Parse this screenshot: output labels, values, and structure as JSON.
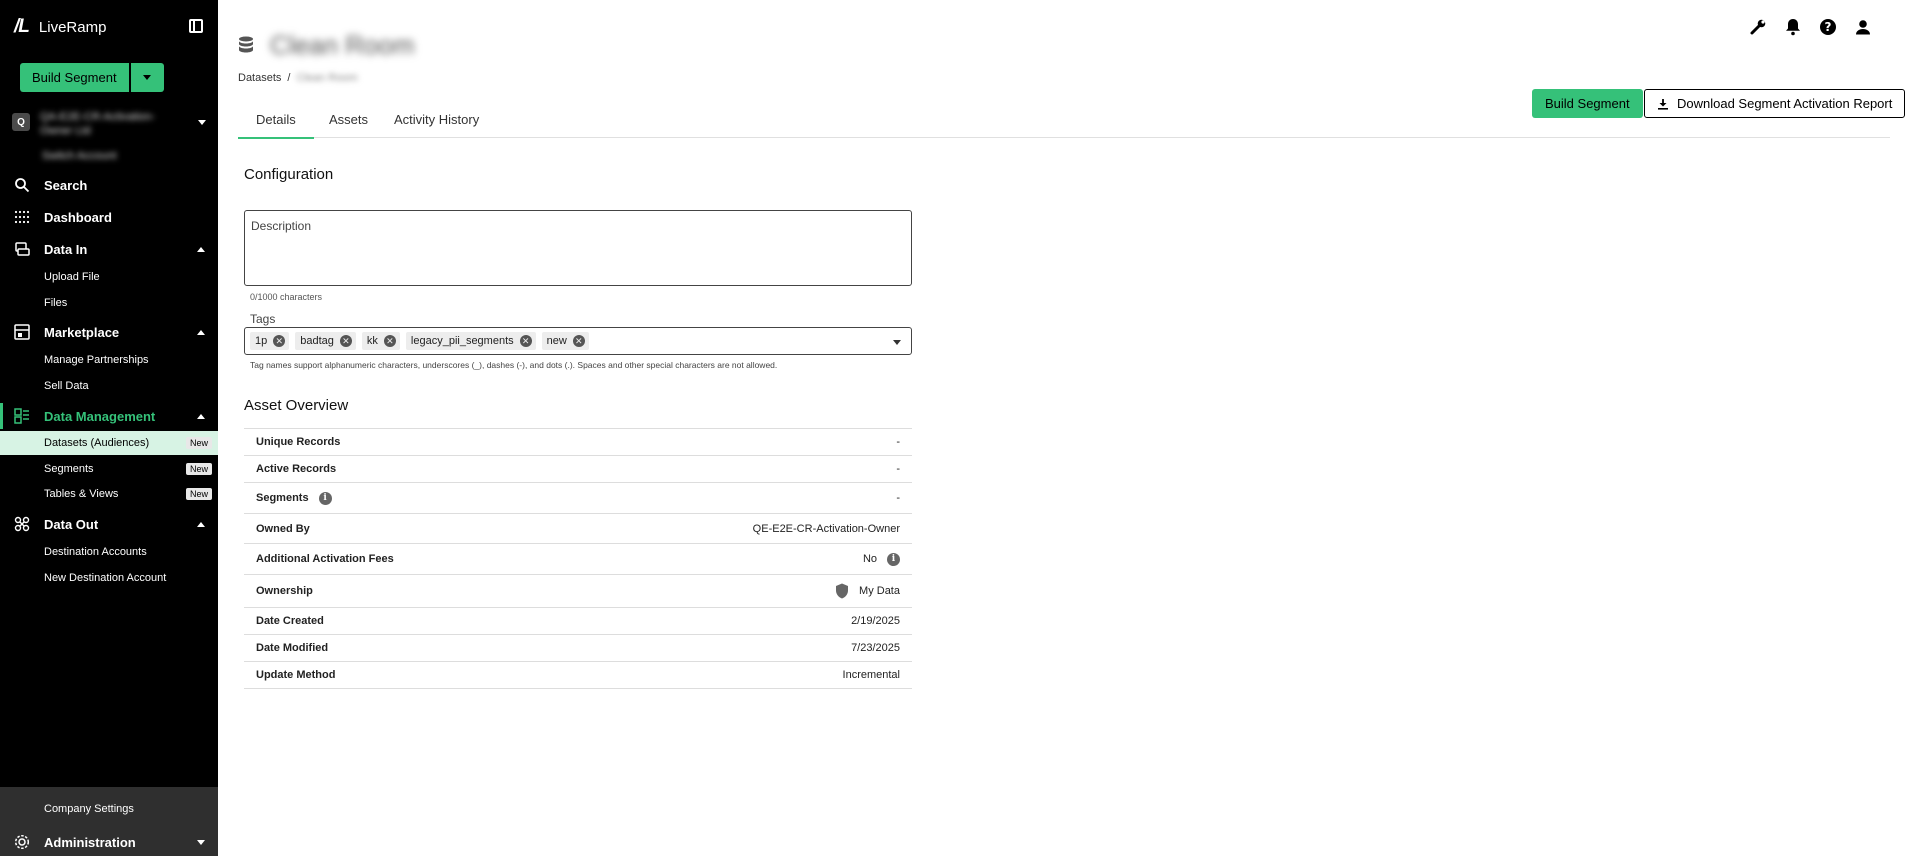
{
  "app": {
    "logo_mark": "/L",
    "name": "LiveRamp",
    "build_segment_label": "Build Segment"
  },
  "org": {
    "badge": "Q",
    "name": "QA-E2E-CR-Activation-Owner Ltd",
    "subtitle": "Switch Account"
  },
  "sidebar": {
    "search": "Search",
    "dashboard": "Dashboard",
    "data_in": "Data In",
    "upload_file": "Upload File",
    "files": "Files",
    "marketplace": "Marketplace",
    "manage_partnerships": "Manage Partnerships",
    "sell_data": "Sell Data",
    "data_management": "Data Management",
    "datasets": "Datasets (Audiences)",
    "segments": "Segments",
    "tables_views": "Tables & Views",
    "new_badge": "New",
    "data_out": "Data Out",
    "destination_accounts": "Destination Accounts",
    "new_destination_account": "New Destination Account",
    "company_settings": "Company Settings",
    "administration": "Administration"
  },
  "page": {
    "title": "Clean Room",
    "breadcrumb_root": "Datasets",
    "breadcrumb_sep": "/",
    "breadcrumb_current": "Clean Room"
  },
  "tabs": [
    "Details",
    "Assets",
    "Activity History"
  ],
  "actions": {
    "build_segment": "Build Segment",
    "download_report": "Download Segment Activation Report"
  },
  "configuration": {
    "title": "Configuration",
    "description_label": "Description",
    "char_count": "0/1000 characters",
    "tags_label": "Tags",
    "tags": [
      "1p",
      "badtag",
      "kk",
      "legacy_pii_segments",
      "new"
    ],
    "tags_help": "Tag names support alphanumeric characters, underscores (_), dashes (-), and dots (.). Spaces and other special characters are not allowed."
  },
  "asset_overview": {
    "title": "Asset Overview",
    "rows": [
      {
        "label": "Unique Records",
        "value": "-"
      },
      {
        "label": "Active Records",
        "value": "-"
      },
      {
        "label": "Segments",
        "value": "-"
      },
      {
        "label": "Owned By",
        "value": "QE-E2E-CR-Activation-Owner"
      },
      {
        "label": "Additional Activation Fees",
        "value": "No"
      },
      {
        "label": "Ownership",
        "value": "My Data"
      },
      {
        "label": "Date Created",
        "value": "2/19/2025"
      },
      {
        "label": "Date Modified",
        "value": "7/23/2025"
      },
      {
        "label": "Update Method",
        "value": "Incremental"
      }
    ]
  },
  "colors": {
    "accent": "#35c179",
    "sidebar_bg": "#000000",
    "active_row_bg": "#d7f3e4"
  }
}
